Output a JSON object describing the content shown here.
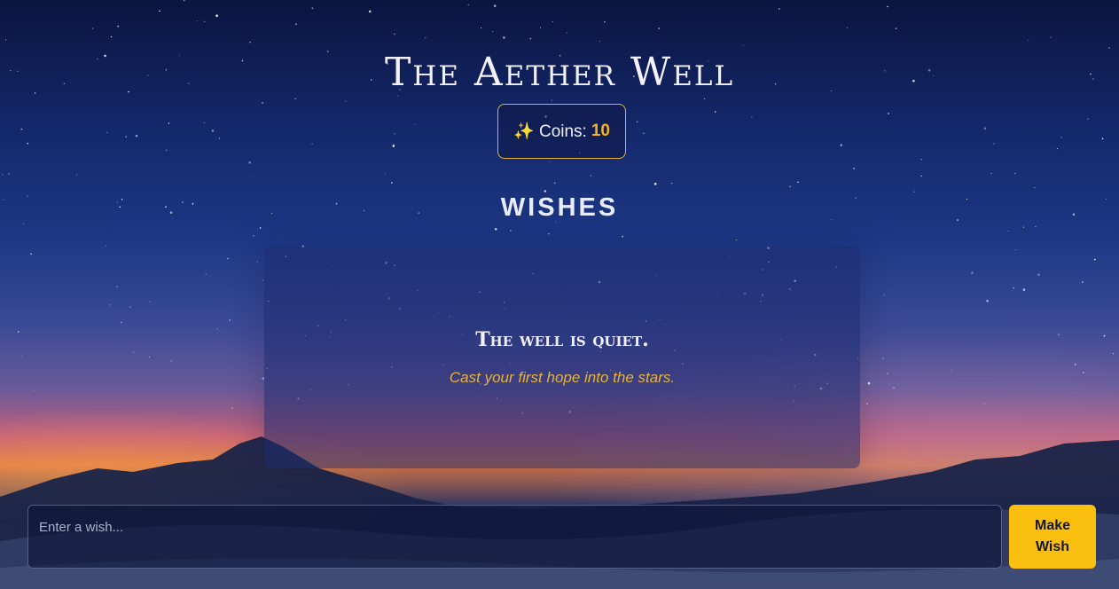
{
  "app": {
    "title": "The Aether Well"
  },
  "coins": {
    "icon": "sparkles-icon",
    "label": "✨ Coins:",
    "value": "10",
    "accent_color": "#f5b323"
  },
  "wishes": {
    "heading": "WISHES",
    "empty_title": "The well is quiet.",
    "empty_subtitle": "Cast your first hope into the stars."
  },
  "composer": {
    "placeholder": "Enter a wish...",
    "value": "",
    "button_label": "Make Wish",
    "button_color": "#fbbf10"
  }
}
